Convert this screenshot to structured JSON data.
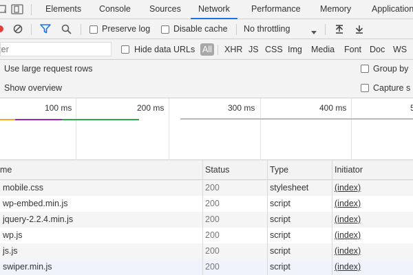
{
  "tabs": [
    {
      "label": "Elements",
      "active": false
    },
    {
      "label": "Console",
      "active": false
    },
    {
      "label": "Sources",
      "active": false
    },
    {
      "label": "Network",
      "active": true
    },
    {
      "label": "Performance",
      "active": false
    },
    {
      "label": "Memory",
      "active": false
    },
    {
      "label": "Application",
      "active": false
    }
  ],
  "toolbar": {
    "preserve_log": {
      "label": "Preserve log",
      "checked": false
    },
    "disable_cache": {
      "label": "Disable cache",
      "checked": false
    },
    "throttling": "No throttling"
  },
  "filter": {
    "placeholder": "Filter",
    "hide_data_urls": {
      "label": "Hide data URLs",
      "checked": false
    },
    "types": [
      "All",
      "XHR",
      "JS",
      "CSS",
      "Img",
      "Media",
      "Font",
      "Doc",
      "WS"
    ],
    "active_type": "All"
  },
  "settings": {
    "large_rows": {
      "label": "Use large request rows",
      "checked": false
    },
    "show_overview": {
      "label": "Show overview",
      "checked": false
    },
    "group_by": {
      "label": "Group by",
      "checked": false
    },
    "capture": {
      "label": "Capture s",
      "checked": false
    }
  },
  "overview": {
    "ticks": [
      "100 ms",
      "200 ms",
      "300 ms",
      "400 ms",
      "5"
    ],
    "colors": {
      "orange": "#f5a623",
      "purple": "#9c27b0",
      "green": "#2ba84a",
      "gray": "#b8b8b8"
    }
  },
  "table": {
    "headers": {
      "name": "me",
      "status": "Status",
      "type": "Type",
      "initiator": "Initiator"
    },
    "rows": [
      {
        "name": "mobile.css",
        "status": "200",
        "type": "stylesheet",
        "initiator": "(index)"
      },
      {
        "name": "wp-embed.min.js",
        "status": "200",
        "type": "script",
        "initiator": "(index)"
      },
      {
        "name": "jquery-2.2.4.min.js",
        "status": "200",
        "type": "script",
        "initiator": "(index)"
      },
      {
        "name": "wp.js",
        "status": "200",
        "type": "script",
        "initiator": "(index)"
      },
      {
        "name": "js.js",
        "status": "200",
        "type": "script",
        "initiator": "(index)"
      },
      {
        "name": "swiper.min.js",
        "status": "200",
        "type": "script",
        "initiator": "(index)"
      }
    ]
  },
  "colors": {
    "accent": "#1a73e8",
    "record_red": "#e33e3e",
    "filter_blue": "#1a73e8"
  }
}
